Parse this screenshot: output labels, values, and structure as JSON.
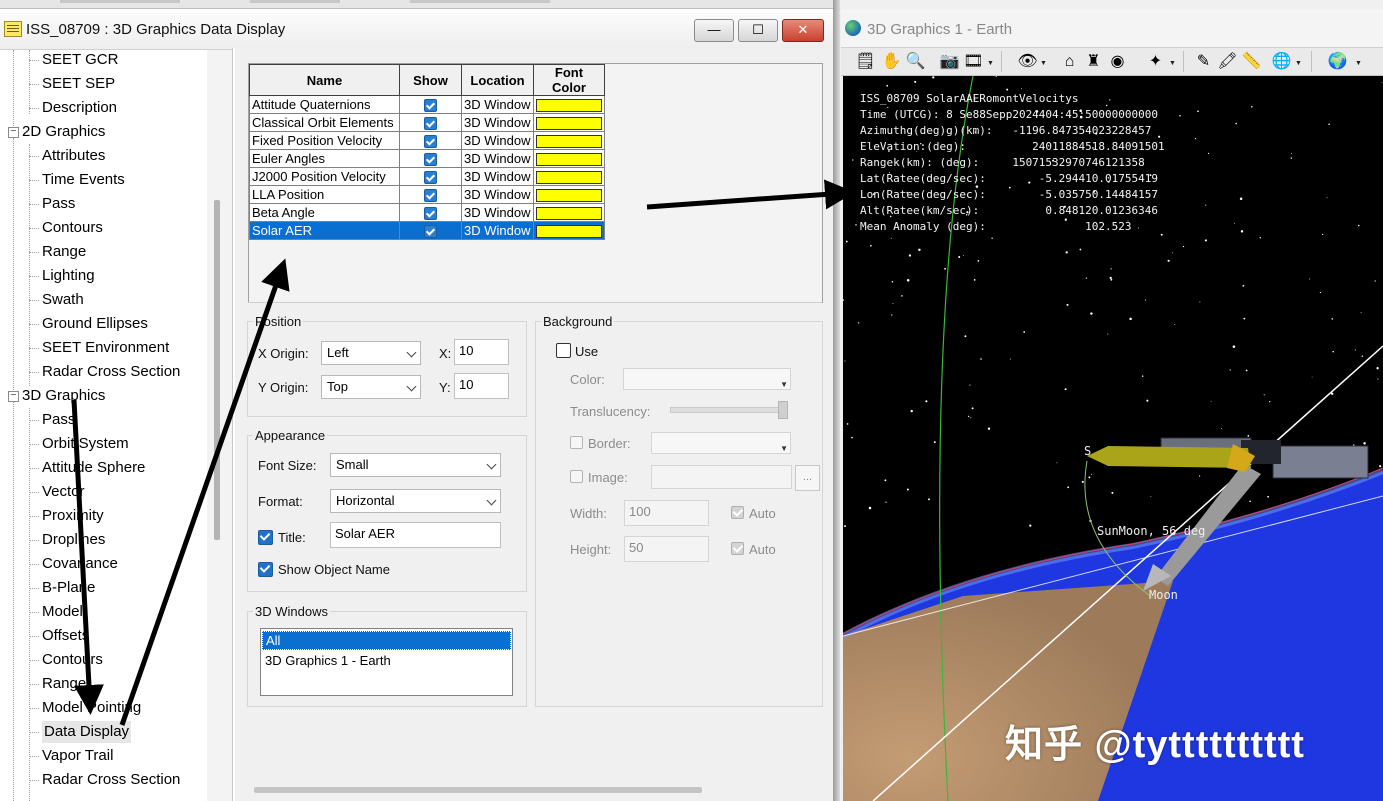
{
  "left_window": {
    "title": "ISS_08709 : 3D Graphics Data Display",
    "buttons": {
      "minimize": "—",
      "maximize": "☐",
      "close": "✕"
    }
  },
  "tree": {
    "items": [
      {
        "label": "SEET GCR"
      },
      {
        "label": "SEET SEP"
      },
      {
        "label": "Description"
      },
      {
        "label": "2D Graphics"
      },
      {
        "label": "Attributes"
      },
      {
        "label": "Time Events"
      },
      {
        "label": "Pass"
      },
      {
        "label": "Contours"
      },
      {
        "label": "Range"
      },
      {
        "label": "Lighting"
      },
      {
        "label": "Swath"
      },
      {
        "label": "Ground Ellipses"
      },
      {
        "label": "SEET Environment"
      },
      {
        "label": "Radar Cross Section"
      },
      {
        "label": "3D Graphics"
      },
      {
        "label": "Pass"
      },
      {
        "label": "Orbit System"
      },
      {
        "label": "Attitude Sphere"
      },
      {
        "label": "Vector"
      },
      {
        "label": "Proximity"
      },
      {
        "label": "Droplines"
      },
      {
        "label": "Covariance"
      },
      {
        "label": "B-Plane"
      },
      {
        "label": "Model"
      },
      {
        "label": "Offsets"
      },
      {
        "label": "Contours"
      },
      {
        "label": "Range"
      },
      {
        "label": "Model Pointing"
      },
      {
        "label": "Data Display"
      },
      {
        "label": "Vapor Trail"
      },
      {
        "label": "Radar Cross Section"
      }
    ]
  },
  "grid": {
    "columns": [
      "Name",
      "Show",
      "Location",
      "Font Color"
    ],
    "rows": [
      {
        "name": "Attitude Quaternions",
        "location": "3D Window"
      },
      {
        "name": "Classical Orbit Elements",
        "location": "3D Window"
      },
      {
        "name": "Fixed Position Velocity",
        "location": "3D Window"
      },
      {
        "name": "Euler Angles",
        "location": "3D Window"
      },
      {
        "name": "J2000 Position Velocity",
        "location": "3D Window"
      },
      {
        "name": "LLA Position",
        "location": "3D Window"
      },
      {
        "name": "Beta Angle",
        "location": "3D Window"
      },
      {
        "name": "Solar AER",
        "location": "3D Window"
      }
    ],
    "font_color": "#ffff00",
    "selection_color": "#0a6fd1"
  },
  "position": {
    "group_label": "Position",
    "x_origin_label": "X Origin:",
    "x_origin_value": "Left",
    "y_origin_label": "Y Origin:",
    "y_origin_value": "Top",
    "x_label": "X:",
    "x_value": "10",
    "y_label": "Y:",
    "y_value": "10"
  },
  "appearance": {
    "group_label": "Appearance",
    "font_size_label": "Font Size:",
    "font_size_value": "Small",
    "format_label": "Format:",
    "format_value": "Horizontal",
    "title_label": "Title:",
    "title_value": "Solar AER",
    "show_object_name_label": "Show Object Name"
  },
  "windows3d": {
    "group_label": "3D Windows",
    "items": [
      "All",
      "3D Graphics 1 - Earth"
    ]
  },
  "background": {
    "group_label": "Background",
    "use_label": "Use",
    "color_label": "Color:",
    "translucency_label": "Translucency:",
    "border_label": "Border:",
    "image_label": "Image:",
    "image_button": "...",
    "width_label": "Width:",
    "width_value": "100",
    "height_label": "Height:",
    "height_value": "50",
    "auto_label": "Auto"
  },
  "right_window": {
    "title": "3D Graphics 1 - Earth",
    "hud_lines": [
      "ISS_08709 SolarAAERomontVelocitys",
      "Time (UTCG): 8 Se88Sepp2024404:45:50000000000",
      "Azimuthg(deg)g)(km):   -1196.847354023228457",
      "EleVation:(deg):          24011884518.84091501",
      "Rangek(km): (deg):     15071532970746121358",
      "Lat(Ratee(deg/sec):        -5.294410.01755419",
      "Lon(Ratee(deg/sec):        -5.035750.14484157",
      "Alt(Ratee(km/sec):          0.848120.01236346",
      "Mean Anomaly (deg):               102.523"
    ],
    "label_sunmoon": "SunMoon, 56   deg",
    "label_moon": "Moon",
    "label_s": "S",
    "watermark": "知乎 @tytttttttttt"
  },
  "colors": {
    "space": "#000000",
    "ocean": "#1f37e0",
    "land": "#b8916c",
    "orbit_line": "#3ab83a",
    "sun_vector": "#c8c400",
    "moon_vector": "#9a9a9a"
  }
}
